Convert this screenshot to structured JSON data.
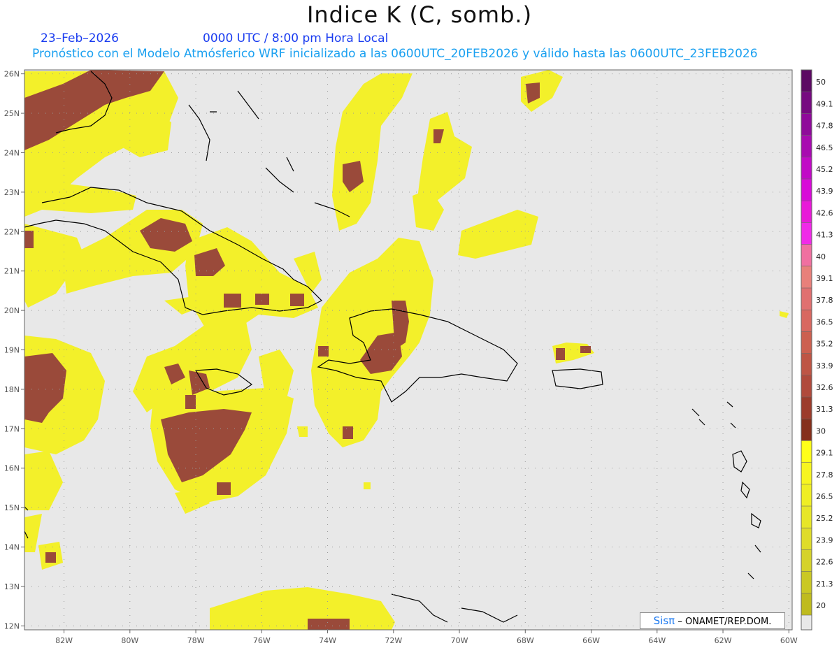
{
  "title": "Indice K (C, somb.)",
  "date": "23–Feb–2026",
  "time": "0000 UTC / 8:00 pm Hora Local",
  "validity": "Pronóstico con el Modelo Atmósferico WRF inicializado a las 0600UTC_20FEB2026 y válido hasta las  0600UTC_23FEB2026",
  "credit": {
    "brand": "Sisπ",
    "org": " – ONAMET/REP.DOM."
  },
  "map": {
    "lon_range": [
      -83.2,
      -59.9
    ],
    "lat_range": [
      11.9,
      26.1
    ],
    "lon_ticks": [
      {
        "v": -82,
        "t": "82W"
      },
      {
        "v": -80,
        "t": "80W"
      },
      {
        "v": -78,
        "t": "78W"
      },
      {
        "v": -76,
        "t": "76W"
      },
      {
        "v": -74,
        "t": "74W"
      },
      {
        "v": -72,
        "t": "72W"
      },
      {
        "v": -70,
        "t": "70W"
      },
      {
        "v": -68,
        "t": "68W"
      },
      {
        "v": -66,
        "t": "66W"
      },
      {
        "v": -64,
        "t": "64W"
      },
      {
        "v": -62,
        "t": "62W"
      },
      {
        "v": -60,
        "t": "60W"
      }
    ],
    "lat_ticks": [
      {
        "v": 12,
        "t": "12N"
      },
      {
        "v": 13,
        "t": "13N"
      },
      {
        "v": 14,
        "t": "14N"
      },
      {
        "v": 15,
        "t": "15N"
      },
      {
        "v": 16,
        "t": "16N"
      },
      {
        "v": 17,
        "t": "17N"
      },
      {
        "v": 18,
        "t": "18N"
      },
      {
        "v": 19,
        "t": "19N"
      },
      {
        "v": 20,
        "t": "20N"
      },
      {
        "v": 21,
        "t": "21N"
      },
      {
        "v": 22,
        "t": "22N"
      },
      {
        "v": 23,
        "t": "23N"
      },
      {
        "v": 24,
        "t": "24N"
      },
      {
        "v": 25,
        "t": "25N"
      },
      {
        "v": 26,
        "t": "26N"
      }
    ],
    "colors": {
      "background": "#e8e8e8",
      "yellow": "#f3f02a",
      "brown": "#9a4a3a"
    }
  },
  "colorbar": {
    "labels": [
      "50",
      "49.1",
      "47.8",
      "46.5",
      "45.2",
      "43.9",
      "42.6",
      "41.3",
      "40",
      "39.1",
      "37.8",
      "36.5",
      "35.2",
      "33.9",
      "32.6",
      "31.3",
      "30",
      "29.1",
      "27.8",
      "26.5",
      "25.2",
      "23.9",
      "22.6",
      "21.3",
      "20"
    ],
    "colors": [
      "#5c0a63",
      "#760a80",
      "#8f0a9a",
      "#a80ab0",
      "#c10ac6",
      "#d80ad8",
      "#e81ad8",
      "#f02ae8",
      "#f070a0",
      "#e8807a",
      "#e07070",
      "#d86860",
      "#cc6050",
      "#be5545",
      "#b04a3c",
      "#9c3c2c",
      "#85301c",
      "#ffff1a",
      "#f7f520",
      "#efee24",
      "#e7e628",
      "#dfdc2a",
      "#d5d22a",
      "#cac824",
      "#bfbb1e"
    ]
  }
}
